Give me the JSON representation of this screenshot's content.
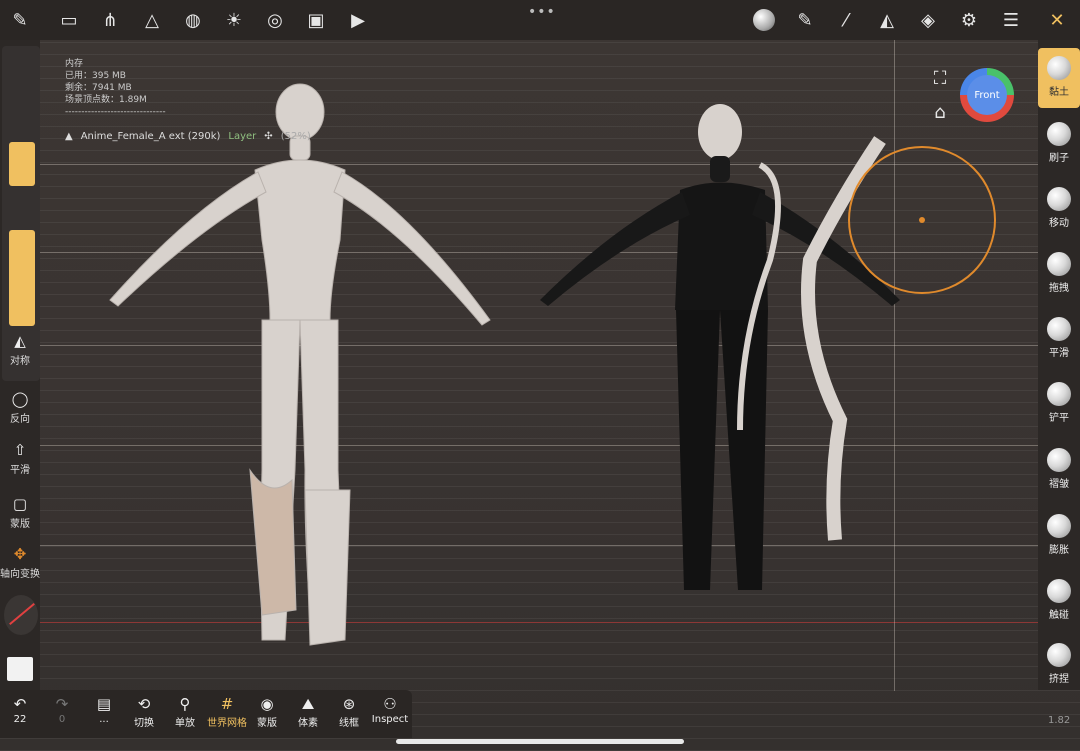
{
  "top_toolbar": {
    "icons": [
      "brush-logo-icon",
      "folder-icon",
      "share-icon",
      "mesh-icon",
      "sphere-icon",
      "light-icon",
      "material-icon",
      "image-icon",
      "video-icon"
    ],
    "right_icons": [
      "matcap-icon",
      "pen-icon",
      "pipette-icon",
      "symmetry-icon",
      "layers-icon",
      "settings-icon",
      "sliders-icon",
      "tools-icon"
    ],
    "more": "•••"
  },
  "info": {
    "header": "内存",
    "used": "已用：395 MB",
    "remaining": "剩余：7941 MB",
    "vertices": "场景顶点数：1.89M",
    "divider": "-------------------------------"
  },
  "layer_line": {
    "object": "Anime_Female_A ext (290k)",
    "layer": "Layer",
    "percent": "(52%)"
  },
  "left_panel": {
    "symmetry_label": "对称",
    "tools": [
      {
        "label": "反向"
      },
      {
        "label": "平滑"
      },
      {
        "label": "蒙版"
      },
      {
        "label": "轴向变换"
      }
    ]
  },
  "right_panel": {
    "tools": [
      {
        "label": "黏土"
      },
      {
        "label": "刷子"
      },
      {
        "label": "移动"
      },
      {
        "label": "拖拽"
      },
      {
        "label": "平滑"
      },
      {
        "label": "铲平"
      },
      {
        "label": "褶皱"
      },
      {
        "label": "膨胀"
      },
      {
        "label": "触碰"
      },
      {
        "label": "挤捏"
      }
    ],
    "active_index": 0
  },
  "gizmo": {
    "face": "Front"
  },
  "bottom_toolbar": {
    "undo_count": "22",
    "redo_count": "0",
    "tools": [
      {
        "label": "..."
      },
      {
        "label": "切换"
      },
      {
        "label": "单放"
      },
      {
        "label": "世界网格"
      },
      {
        "label": "蒙版"
      },
      {
        "label": "体素"
      },
      {
        "label": "线框"
      },
      {
        "label": "Inspect"
      }
    ],
    "active_label": "世界网格"
  },
  "corner_number": "1.82",
  "colors": {
    "accent": "#f0c060",
    "brush_ring": "#e08a2c",
    "topbar": "#2a2624",
    "viewport": "#3a3432"
  }
}
